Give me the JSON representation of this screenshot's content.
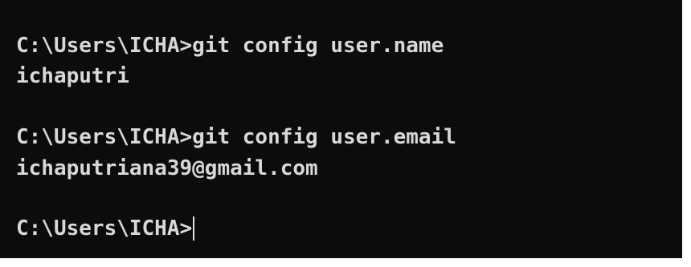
{
  "terminal": {
    "lines": [
      {
        "prompt": "C:\\Users\\ICHA>",
        "command": "git config user.name"
      },
      {
        "output": "ichaputri"
      },
      {
        "prompt": "C:\\Users\\ICHA>",
        "command": "git config user.email"
      },
      {
        "output": "ichaputriana39@gmail.com"
      },
      {
        "prompt": "C:\\Users\\ICHA>",
        "command": ""
      }
    ],
    "colors": {
      "background": "#0c0c0c",
      "text": "#d8d8d8",
      "frame": "#ffffff"
    }
  }
}
